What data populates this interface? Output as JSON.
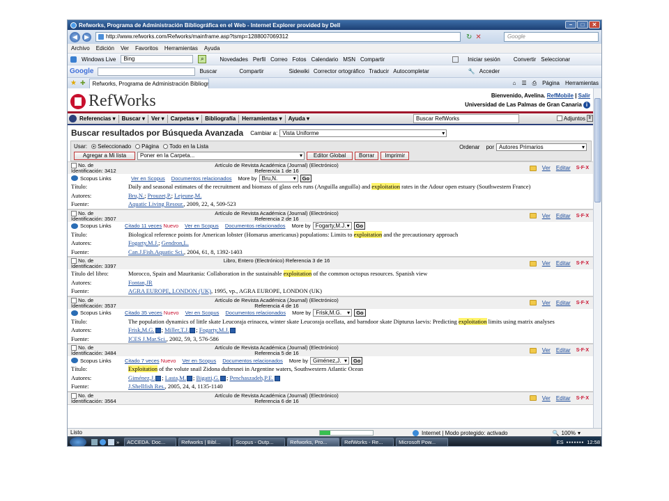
{
  "window": {
    "title": "Refworks, Programa de Administración Bibliográfica en el Web - Internet Explorer provided by Dell",
    "url": "http://www.refworks.com/Refworks/mainframe.asp?tsmp=1288007069312",
    "search_placeholder": "Google"
  },
  "menu": [
    "Archivo",
    "Edición",
    "Ver",
    "Favoritos",
    "Herramientas",
    "Ayuda"
  ],
  "wl_toolbar": {
    "brand": "Windows Live",
    "search": "Bing",
    "items": [
      "Novedades",
      "Perfil",
      "Correo",
      "Fotos",
      "Calendario",
      "MSN",
      "Compartir"
    ],
    "signin": "Iniciar sesión",
    "convert": "Convertir",
    "select": "Seleccionar"
  },
  "google_toolbar": {
    "logo": "Google",
    "items": [
      "Buscar",
      "Compartir",
      "Sidewiki",
      "Corrector ortográfico",
      "Traducir",
      "Autocompletar"
    ],
    "login": "Acceder"
  },
  "tab": {
    "title": "Refworks, Programa de Administración Bibliográf...",
    "right": [
      "Página",
      "Herramientas"
    ]
  },
  "rw": {
    "logo": "RefWorks",
    "welcome": "Bienvenido, Avelina.",
    "refmobile": "RefMobile",
    "logout": "Salir",
    "university": "Universidad de Las Palmas de Gran Canaria",
    "nav": [
      "Referencias",
      "Buscar",
      "Ver",
      "Carpetas",
      "Bibliografía",
      "Herramientas",
      "Ayuda"
    ],
    "search_label": "Buscar RefWorks",
    "attachments": "Adjuntos",
    "heading": "Buscar resultados por Búsqueda Avanzada",
    "cambiar": "Cambiar a:",
    "view": "Vista Uniforme",
    "usar": "Usar:",
    "radios": [
      "Seleccionado",
      "Página",
      "Todo en la Lista"
    ],
    "add_list": "Agregar a Mi lista",
    "folder_sel": "Poner en la Carpeta...",
    "global_edit": "Editor Global",
    "delete": "Borrar",
    "print": "Imprimir",
    "order_label": "Ordenar",
    "order_by": "por",
    "order_value": "Autores Primarios",
    "ver": "Ver",
    "editar": "Editar",
    "sfx": "S·F·X",
    "no_de": "No. de",
    "ident": "Identificación:",
    "scopus": "Scopus Links",
    "ver_scopus": "Ver en Scopus",
    "docs_rel": "Documentos relacionados",
    "more_by": "More by",
    "go": "Go",
    "nuevo": "Nuevo"
  },
  "records": [
    {
      "id": "3412",
      "type": "Artículo de Revista Académica (Journal) (Electrónico)",
      "ref": "Referencia 1 de 16",
      "cited": "",
      "more_by": "Bru,N.",
      "fields": [
        {
          "label": "Título:",
          "pre": "Daily and seasonal estimates of the recruitment and biomass of glass eels runs (Anguilla anguilla) and ",
          "hl": "exploitation",
          "post": " rates in the Adour open estuary (Southwestern France)"
        },
        {
          "label": "Autores:",
          "links": [
            "Bru,N.",
            "Prouzet,P.",
            "Lejeune,M."
          ],
          "icons": false
        },
        {
          "label": "Fuente:",
          "link": "Aquatic Living Resour.",
          "rest": ", 2009, 22, 4, 509-523"
        }
      ]
    },
    {
      "id": "3507",
      "type": "Artículo de Revista Académica (Journal) (Electrónico)",
      "ref": "Referencia 2 de 16",
      "cited": "Citado 11 veces",
      "more_by": "Fogarty,M.J.",
      "fields": [
        {
          "label": "Título:",
          "pre": "Biological reference points for American lobster (Homarus americanus) populations: Limits to ",
          "hl": "exploitation",
          "post": " and the precautionary approach"
        },
        {
          "label": "Autores:",
          "links": [
            "Fogarty,M.J.",
            "Gendron,L."
          ],
          "icons": false
        },
        {
          "label": "Fuente:",
          "link": "Can.J.Fish.Aquatic Sci.",
          "rest": ", 2004, 61, 8, 1392-1403"
        }
      ]
    },
    {
      "id": "3397",
      "type": "Libro, Entero (Electrónico) Referencia 3 de 16",
      "ref": "",
      "cited": "",
      "more_by": "",
      "fields": [
        {
          "label": "Título del libro:",
          "pre": "Morocco, Spain and Mauritania: Collaboration in the sustainable ",
          "hl": "exploitation",
          "post": " of the common octopus resources. Spanish view"
        },
        {
          "label": "Autores:",
          "links": [
            "Fontan,JR"
          ],
          "icons": false
        },
        {
          "label": "Fuente:",
          "link": "AGRA EUROPE, LONDON (UK)",
          "rest": ", 1995, vp., AGRA EUROPE, LONDON (UK)"
        }
      ]
    },
    {
      "id": "3537",
      "type": "Artículo de Revista Académica (Journal) (Electrónico)",
      "ref": "Referencia 4 de 16",
      "cited": "Citado 35 veces",
      "more_by": "Frisk,M.G.",
      "fields": [
        {
          "label": "Título:",
          "pre": "The population dynamics of little skate Leucoraja erinacea, winter skate Leucoraja ocellata, and barndoor skate Dipturus laevis: Predicting ",
          "hl": "exploitation",
          "post": " limits using matrix analyses"
        },
        {
          "label": "Autores:",
          "links": [
            "Frisk,M.G.",
            "Miller,T.J.",
            "Fogarty,M.J."
          ],
          "icons": true
        },
        {
          "label": "Fuente:",
          "link": "ICES J.Mar.Sci.",
          "rest": ", 2002, 59, 3, 576-586"
        }
      ]
    },
    {
      "id": "3484",
      "type": "Artículo de Revista Académica (Journal) (Electrónico)",
      "ref": "Referencia 5 de 16",
      "cited": "Citado 7 veces",
      "more_by": "Giménez,J.",
      "fields": [
        {
          "label": "Título:",
          "pre": "",
          "hl": "Exploitation",
          "post": " of the volute snail Zidona dufresnei in Argentine waters, Southwestern Atlantic Ocean"
        },
        {
          "label": "Autores:",
          "links": [
            "Giménez,J.",
            "Lasta,M.",
            "Bigatti,G.",
            "Penchaszadeh,P.E."
          ],
          "icons": true
        },
        {
          "label": "Fuente:",
          "link": "J.Shellfish Res.",
          "rest": ", 2005, 24, 4, 1135-1140"
        }
      ]
    },
    {
      "id": "3564",
      "type": "Artículo de Revista Académica (Journal) (Electrónico)",
      "ref": "Referencia 6 de 16",
      "cited": "",
      "more_by": "",
      "fields": []
    }
  ],
  "status": {
    "text": "Listo",
    "zone": "Internet | Modo protegido: activado",
    "zoom": "100%",
    "progress": 0.2
  },
  "taskbar": {
    "items": [
      "ACCEDA. Doc...",
      "Refworks | Bibl...",
      "Scopus - Outp...",
      "Refworks, Pro...",
      "RefWorks - Re...",
      "Microsoft Pow..."
    ],
    "lang": "ES",
    "clock": "12:58"
  }
}
